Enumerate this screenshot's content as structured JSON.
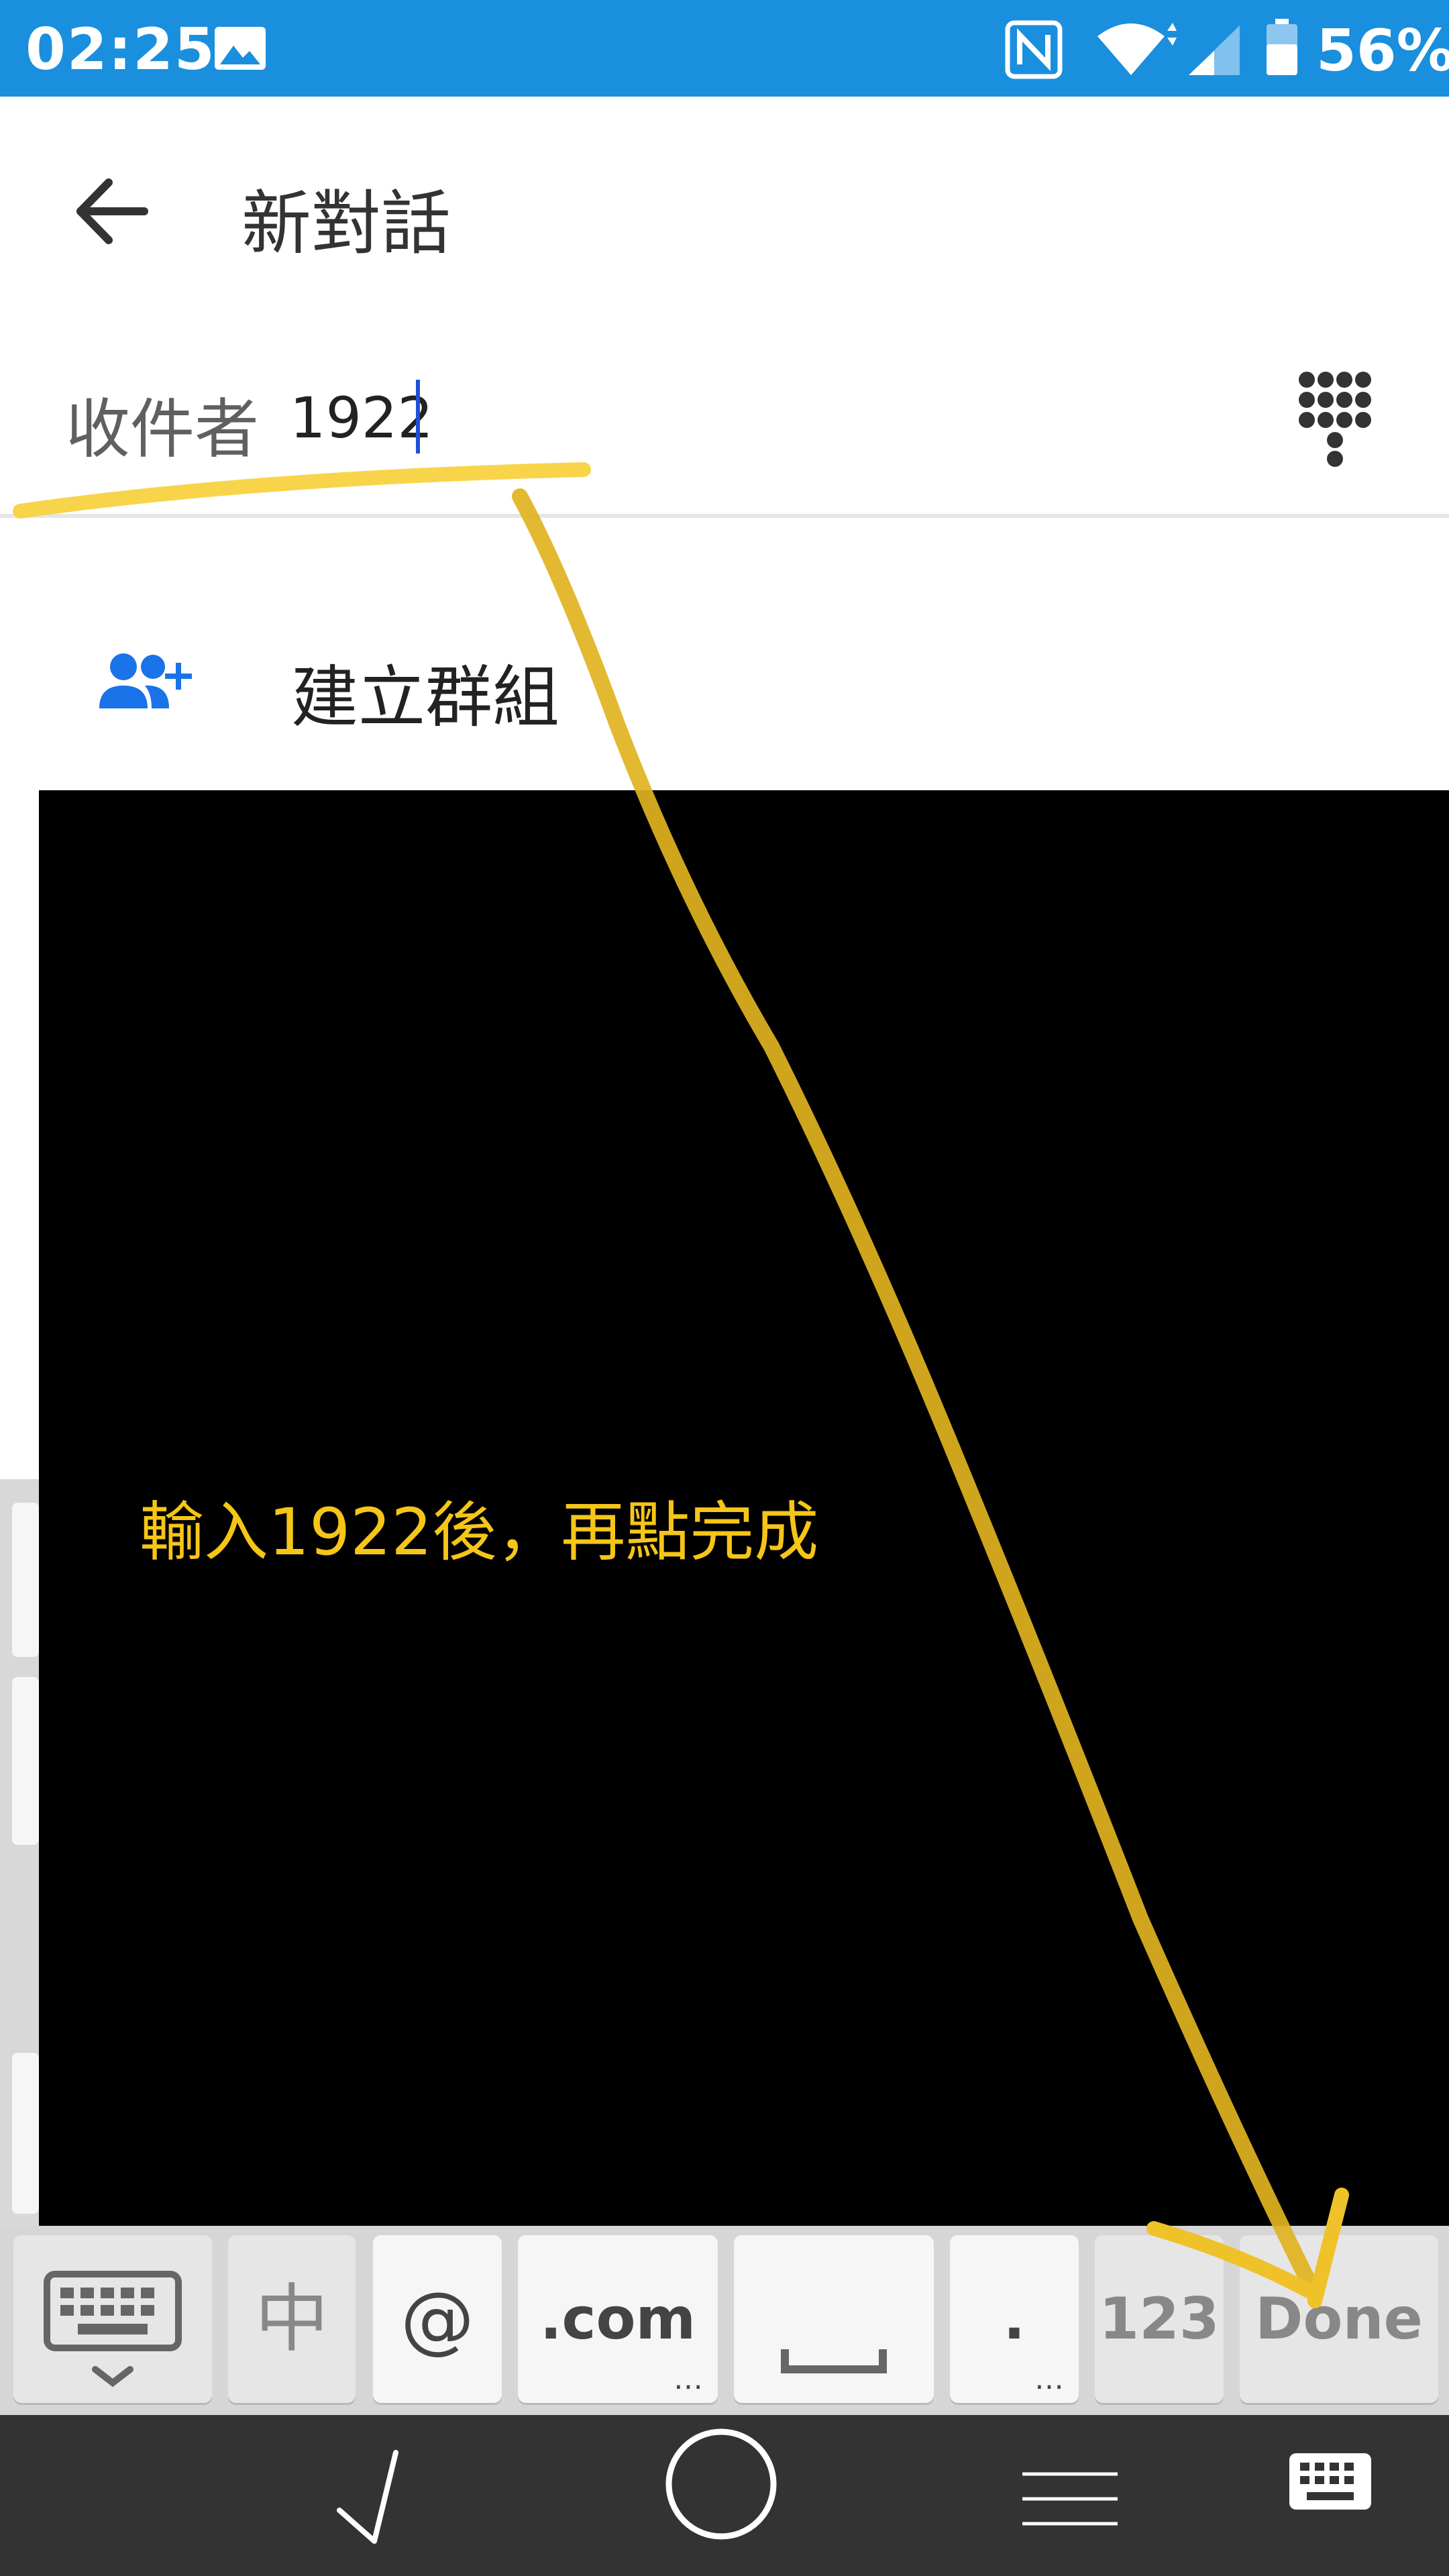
{
  "status_bar": {
    "time": "02:25",
    "battery_percent": "56%",
    "icons": [
      "image-icon",
      "nfc-icon",
      "wifi-icon",
      "signal-icon",
      "battery-icon"
    ],
    "background_color": "#1a8fde"
  },
  "app_bar": {
    "back_icon": "arrow-left-icon",
    "title": "新對話"
  },
  "recipient": {
    "label": "收件者",
    "value": "1922",
    "dialpad_icon": "dialpad-icon"
  },
  "actions": {
    "create_group_label": "建立群組",
    "create_group_icon": "group-add-icon"
  },
  "overlay": {
    "instruction": "輸入1922後，再點完成",
    "text_color": "#f5c518"
  },
  "keyboard": {
    "keys": {
      "switch_keyboard_icon": "keyboard-icon",
      "zh": "中",
      "at": "@",
      "com": ".com",
      "space_icon": "space-icon",
      "dot": ".",
      "num": "123",
      "done": "Done"
    }
  },
  "nav_bar": {
    "icons": [
      "back-down-icon",
      "home-icon",
      "menu-icon",
      "keyboard-icon"
    ]
  }
}
